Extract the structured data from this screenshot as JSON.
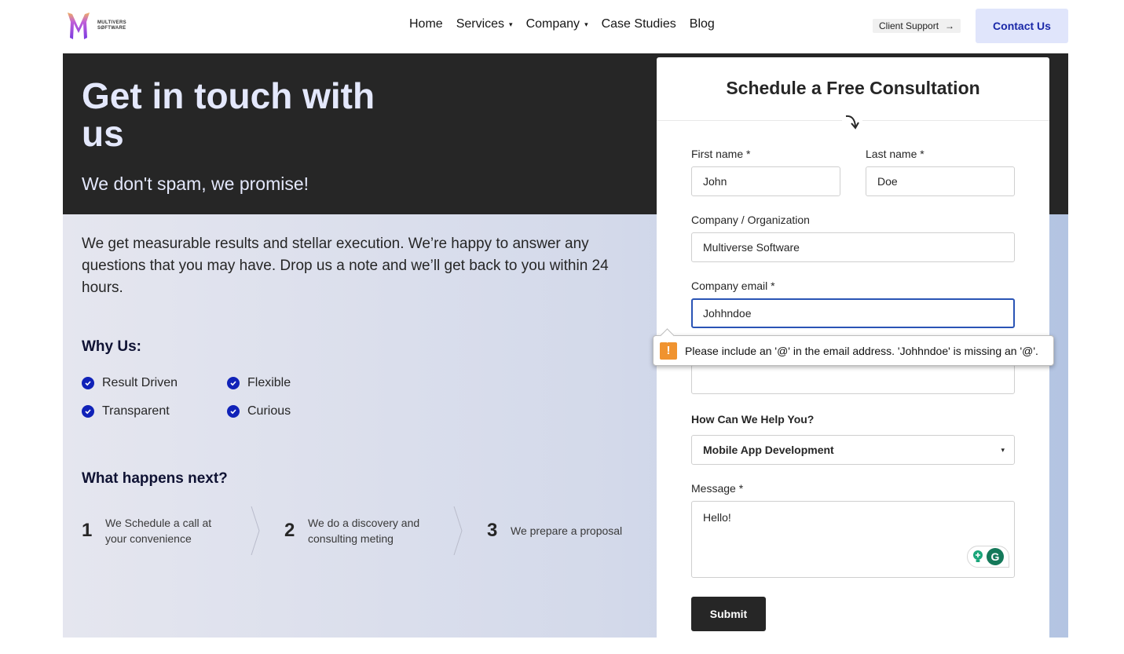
{
  "header": {
    "logo_text_line1": "MULTIVERS",
    "logo_text_line2": "SØFTWARE",
    "nav": [
      {
        "label": "Home",
        "has_caret": false
      },
      {
        "label": "Services",
        "has_caret": true
      },
      {
        "label": "Company",
        "has_caret": true
      },
      {
        "label": "Case Studies",
        "has_caret": false
      },
      {
        "label": "Blog",
        "has_caret": false
      }
    ],
    "caret_glyph": "▾",
    "client_support_label": "Client Support",
    "client_support_arrow": "→",
    "contact_label": "Contact Us"
  },
  "hero": {
    "title": "Get in touch with us",
    "subtitle": "We don't spam, we promise!"
  },
  "info": {
    "intro": "We get measurable results and stellar execution. We’re happy to answer any questions that you may have. Drop us a note and we’ll get back to you within 24 hours.",
    "why_title": "Why Us:",
    "why_items": [
      "Result Driven",
      "Flexible",
      "Transparent",
      "Curious"
    ],
    "next_title": "What happens next?",
    "steps": [
      {
        "num": "1",
        "text": "We Schedule a call at your convenience"
      },
      {
        "num": "2",
        "text": "We do a discovery and consulting meting"
      },
      {
        "num": "3",
        "text": "We prepare a proposal"
      }
    ]
  },
  "form": {
    "title": "Schedule a Free Consultation",
    "first_name_label": "First name *",
    "first_name_value": "John",
    "last_name_label": "Last name *",
    "last_name_value": "Doe",
    "company_label": "Company / Organization",
    "company_value": "Multiverse Software",
    "email_label": "Company email *",
    "email_value": "Johhndoe",
    "hidden_field_value": "",
    "help_label": "How Can We Help You?",
    "help_selected": "Mobile App Development",
    "select_caret": "▾",
    "message_label": "Message *",
    "message_value": "Hello!",
    "grammarly_letter": "G",
    "submit_label": "Submit"
  },
  "tooltip": {
    "icon": "!",
    "message": "Please include an '@' in the email address. 'Johhndoe' is missing an '@'."
  },
  "colors": {
    "accent_blue": "#1022b8",
    "hero_bg": "#262626",
    "contact_bg": "#e0e5fb",
    "warning": "#f0932f"
  }
}
